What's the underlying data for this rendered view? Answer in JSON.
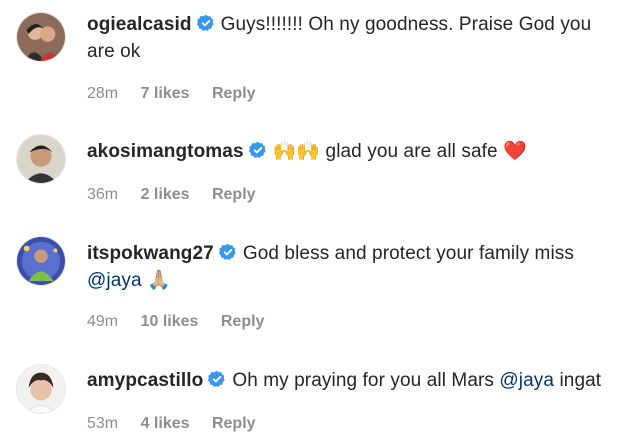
{
  "comments": [
    {
      "username": "ogiealcasid",
      "text": "Guys!!!!!!! Oh ny goodness. Praise God you are ok",
      "time": "28m",
      "likes": "7 likes",
      "reply": "Reply"
    },
    {
      "username": "akosimangtomas",
      "emoji": "🙌🙌",
      "text": "glad you are all safe",
      "heart": "❤️",
      "time": "36m",
      "likes": "2 likes",
      "reply": "Reply"
    },
    {
      "username": "itspokwang27",
      "text": "God bless and protect your family miss",
      "mention": "@jaya",
      "emoji": "🙏🏼",
      "time": "49m",
      "likes": "10 likes",
      "reply": "Reply"
    },
    {
      "username": "amypcastillo",
      "text": "Oh my praying for you all Mars",
      "mention": "@jaya",
      "text_after": "ingat",
      "time": "53m",
      "likes": "4 likes",
      "reply": "Reply"
    }
  ],
  "colors": {
    "verified": "#3897f0",
    "mention": "#00376b",
    "meta": "#8e8e8e"
  }
}
